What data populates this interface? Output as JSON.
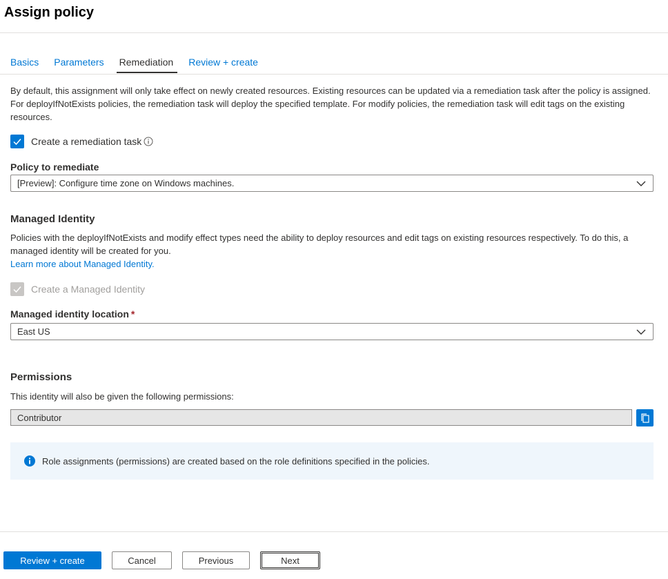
{
  "page": {
    "title": "Assign policy"
  },
  "tabs": [
    {
      "label": "Basics",
      "active": false
    },
    {
      "label": "Parameters",
      "active": false
    },
    {
      "label": "Remediation",
      "active": true
    },
    {
      "label": "Review + create",
      "active": false
    }
  ],
  "remediation": {
    "description": "By default, this assignment will only take effect on newly created resources. Existing resources can be updated via a remediation task after the policy is assigned. For deployIfNotExists policies, the remediation task will deploy the specified template. For modify policies, the remediation task will edit tags on the existing resources.",
    "create_task_label": "Create a remediation task",
    "create_task_checked": true,
    "policy_label": "Policy to remediate",
    "policy_value": "[Preview]: Configure time zone on Windows machines."
  },
  "managed_identity": {
    "title": "Managed Identity",
    "description": "Policies with the deployIfNotExists and modify effect types need the ability to deploy resources and edit tags on existing resources respectively. To do this, a managed identity will be created for you.",
    "learn_more": "Learn more about Managed Identity.",
    "create_label": "Create a Managed Identity",
    "create_checked": true,
    "location_label": "Managed identity location",
    "required_marker": "*",
    "location_value": "East US"
  },
  "permissions": {
    "title": "Permissions",
    "description": "This identity will also be given the following permissions:",
    "value": "Contributor",
    "info": "Role assignments (permissions) are created based on the role definitions specified in the policies."
  },
  "footer": {
    "review_create": "Review + create",
    "cancel": "Cancel",
    "previous": "Previous",
    "next": "Next"
  },
  "colors": {
    "accent": "#0078d4",
    "info_background": "#eff6fc",
    "required": "#a4262c"
  },
  "icons": {
    "info": "info-circle-icon",
    "chevron": "chevron-down-icon",
    "copy": "copy-icon",
    "check": "checkmark-icon"
  }
}
